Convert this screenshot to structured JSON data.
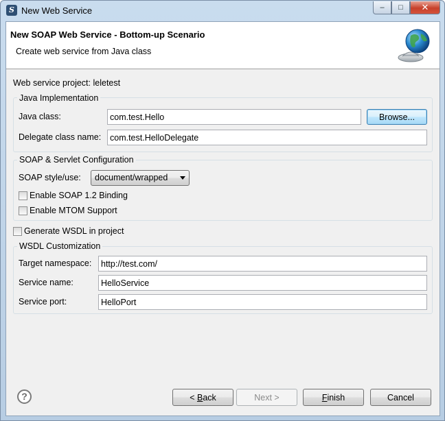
{
  "window": {
    "title": "New Web Service",
    "icon": "eclipse-s-icon",
    "controls": {
      "minimize": "‒",
      "maximize": "□",
      "close": "✕"
    }
  },
  "banner": {
    "title": "New SOAP Web Service - Bottom-up Scenario",
    "description": "Create web service from Java class",
    "icon": "globe-service-icon"
  },
  "project": {
    "label": "Web service project: leletest"
  },
  "java_implementation": {
    "title": "Java Implementation",
    "java_class_label": "Java class:",
    "java_class_value": "com.test.Hello",
    "browse_label": "Browse...",
    "delegate_label": "Delegate class name:",
    "delegate_value": "com.test.HelloDelegate"
  },
  "soap_config": {
    "title": "SOAP & Servlet Configuration",
    "style_label": "SOAP style/use:",
    "style_value": "document/wrapped",
    "soap12_label": "Enable SOAP 1.2 Binding",
    "soap12_checked": false,
    "mtom_label": "Enable MTOM Support",
    "mtom_checked": false
  },
  "generate_wsdl": {
    "label": "Generate WSDL in project",
    "checked": false
  },
  "wsdl_customization": {
    "title": "WSDL Customization",
    "namespace_label": "Target namespace:",
    "namespace_value": "http://test.com/",
    "service_label": "Service name:",
    "service_value": "HelloService",
    "port_label": "Service port:",
    "port_value": "HelloPort"
  },
  "footer": {
    "help": "?",
    "back_prefix": "< ",
    "back_mnemonic": "B",
    "back_rest": "ack",
    "next_label": "Next >",
    "finish_mnemonic": "F",
    "finish_rest": "inish",
    "cancel_label": "Cancel"
  },
  "colors": {
    "title_bar": "#c9dcee",
    "dialog_bg": "#f0f0f0",
    "close_button": "#c7402a"
  }
}
